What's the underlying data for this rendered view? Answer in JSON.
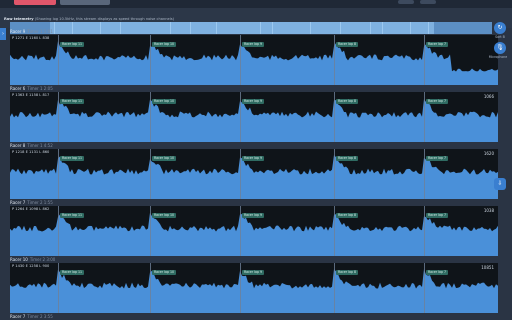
{
  "app": {
    "accent": "#e0566a",
    "chart_fill": "#4a90d9",
    "badge_color": "#2f6b62"
  },
  "raw_telemetry": {
    "label": "Raw telemetry",
    "hint": "(Showing log 10.5kHz, this stream displays as speed through noise channels)"
  },
  "sidebar": {
    "items": [
      {
        "icon": "refresh-icon",
        "label": "Sort B"
      },
      {
        "icon": "microphone-icon",
        "label": "Microphone"
      },
      {
        "icon": "export-icon",
        "label": ""
      }
    ]
  },
  "left_tab": {
    "icon": "chevron-right-icon"
  },
  "racers": [
    {
      "name": "Racer 9",
      "sub": "Timer 1 1:01",
      "stats": "P 1271 E 1160 L 838",
      "score": "",
      "badges": [
        "Racer lap 11",
        "Racer lap 10",
        "Racer lap 9",
        "Racer lap 8",
        "Racer lap 7"
      ]
    },
    {
      "name": "Racer 6",
      "sub": "Timer 1 2:05",
      "stats": "P 1363 E 1158 L 817",
      "score": "1066",
      "badges": [
        "Racer lap 11",
        "Racer lap 10",
        "Racer lap 9",
        "Racer lap 8",
        "Racer lap 7"
      ]
    },
    {
      "name": "Racer 8",
      "sub": "Timer 1 4:52",
      "stats": "P 1218 E 1131 L 860",
      "score": "1620",
      "badges": [
        "Racer lap 11",
        "Racer lap 10",
        "Racer lap 9",
        "Racer lap 8",
        "Racer lap 7"
      ]
    },
    {
      "name": "Racer 7",
      "sub": "Timer 2 1:55",
      "stats": "P 1264 E 1098 L 862",
      "score": "1038",
      "badges": [
        "Racer lap 11",
        "Racer lap 10",
        "Racer lap 9",
        "Racer lap 8",
        "Racer lap 7"
      ]
    },
    {
      "name": "Racer 10",
      "sub": "Timer 2 3:00",
      "stats": "P 1430 E 1258 L 900",
      "score": "10851",
      "badges": [
        "Racer lap 11",
        "Racer lap 10",
        "Racer lap 9",
        "Racer lap 8",
        "Racer lap 7"
      ]
    },
    {
      "name": "Racer 7",
      "sub": "Timer 2 3:55",
      "stats": "",
      "score": "",
      "badges": []
    }
  ]
}
